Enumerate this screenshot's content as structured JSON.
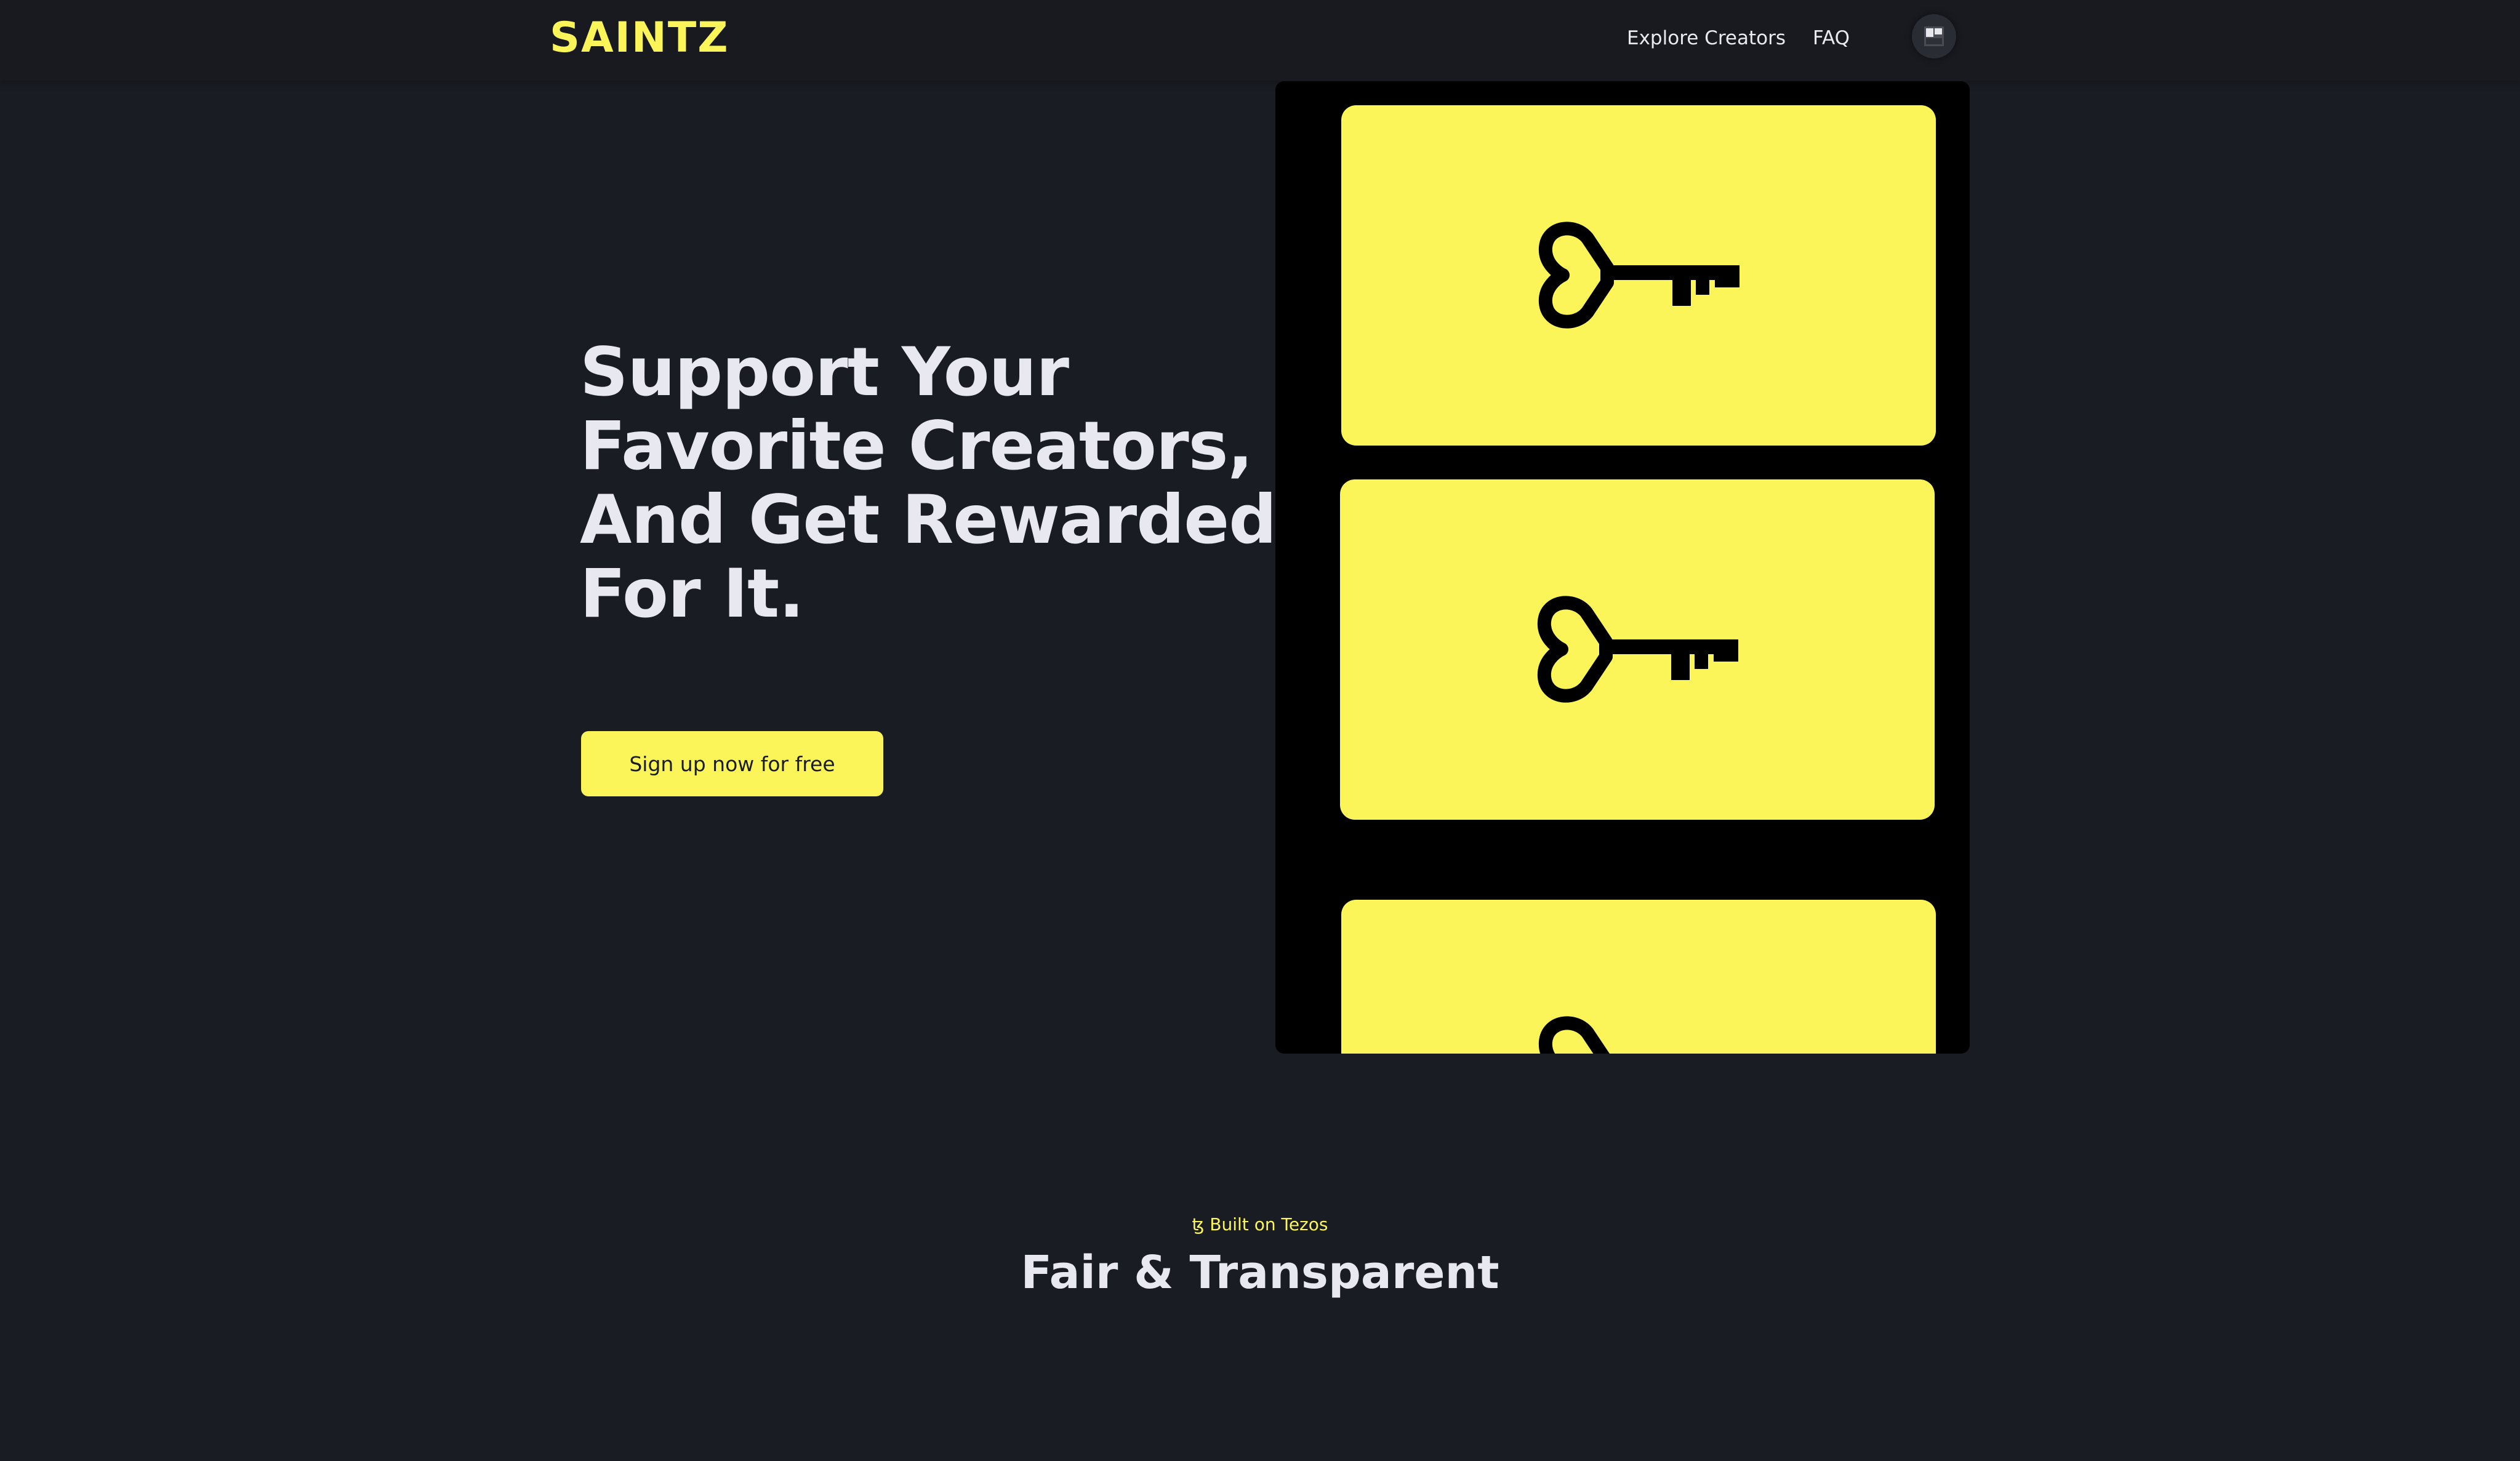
{
  "header": {
    "logo": "SAINTZ",
    "nav": [
      {
        "label": "Explore Creators"
      },
      {
        "label": "FAQ"
      }
    ]
  },
  "hero": {
    "title_lines": [
      "Support Your",
      "Favorite Creators,",
      "And Get Rewarded",
      "For It."
    ],
    "cta_label": "Sign up now for free"
  },
  "section": {
    "tag": "ꜩ Built on Tezos",
    "title": "Fair & Transparent"
  },
  "colors": {
    "background": "#1a1c23",
    "accent": "#fbf55a",
    "panel": "#000000"
  },
  "icons": [
    "heart-key-icon",
    "avatar-icon"
  ]
}
